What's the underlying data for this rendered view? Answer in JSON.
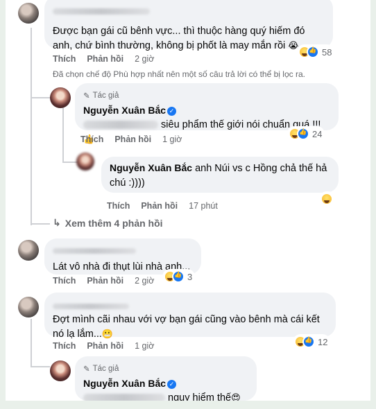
{
  "comments": {
    "c1": {
      "text": "Được bạn gái cũ bênh vực... thì thuộc hàng quý hiếm đó anh, chứ bình thường, không bị phốt là may mắn rồi",
      "emoji": "😭",
      "like": "Thích",
      "reply": "Phản hồi",
      "time": "2 giờ",
      "reactions": "58"
    },
    "notice": "Đã chọn chế độ Phù hợp nhất nên một số câu trả lời có thể bị lọc ra.",
    "r1": {
      "author_tag": "Tác giả",
      "name": "Nguyễn Xuân Bắc",
      "text": "siêu phẩm thế giới nói chuẩn quá !!!",
      "emoji": "👍",
      "like": "Thích",
      "reply": "Phản hồi",
      "time": "1 giờ",
      "reactions": "24"
    },
    "r2": {
      "name": "Nguyễn Xuân Bắc",
      "text": "anh Núi vs c Hồng chả thế hả chú :))))",
      "like": "Thích",
      "reply": "Phản hồi",
      "time": "17 phút"
    },
    "more": "Xem thêm 4 phản hồi",
    "c2": {
      "text": "Lát vô nhà đi thụt lùi nhà anh...",
      "like": "Thích",
      "reply": "Phản hồi",
      "time": "2 giờ",
      "reactions": "3"
    },
    "c3": {
      "text": "Đợt mình cãi nhau với vợ bạn gái cũng vào bênh mà cái kết nó lạ lắm...",
      "emoji": "😬",
      "like": "Thích",
      "reply": "Phản hồi",
      "time": "1 giờ",
      "reactions": "12"
    },
    "r3": {
      "author_tag": "Tác giả",
      "name": "Nguyễn Xuân Bắc",
      "text": "nguy hiểm thế",
      "emoji": "😍"
    }
  },
  "icons": [
    "pencil-icon",
    "verified-badge-icon",
    "reply-arrow-icon",
    "haha-reaction-icon",
    "like-reaction-icon",
    "wow-reaction-icon"
  ],
  "colors": {
    "meta": "#65676b",
    "bubble": "#f0f2f5",
    "like_blue": "#1877f2",
    "background": "#e9f0ea"
  }
}
